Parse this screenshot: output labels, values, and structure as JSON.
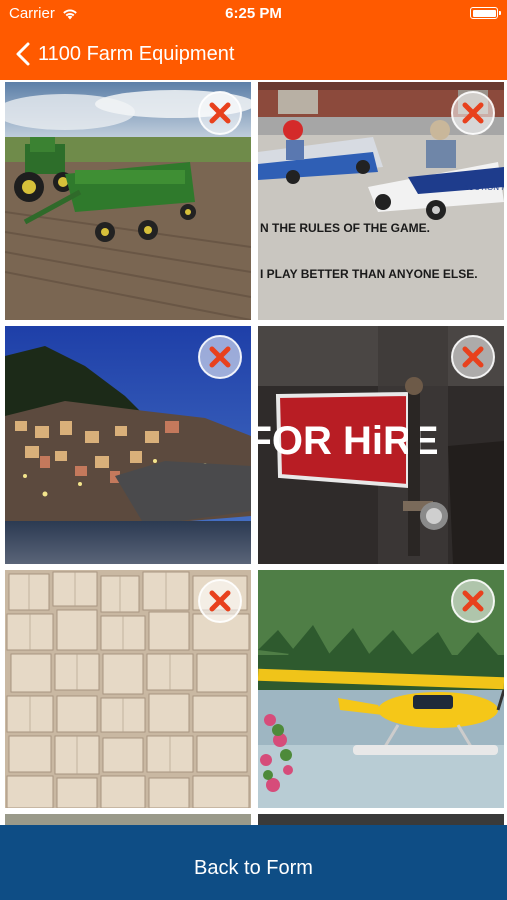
{
  "status_bar": {
    "carrier": "Carrier",
    "time": "6:25 PM"
  },
  "nav": {
    "title": "1100 Farm Equipment"
  },
  "images": [
    {
      "subject": "green tractor pulling seed drill in plowed field",
      "remove_icon": "close-icon"
    },
    {
      "subject": "children racing soapbox derby cars",
      "caption_lines": [
        "N THE RULES OF THE GAME.",
        "I PLAY BETTER THAN ANYONE ELSE."
      ],
      "car_text": "AUCTION METHO",
      "remove_icon": "close-icon"
    },
    {
      "subject": "coastal village on cliff at dusk",
      "remove_icon": "close-icon"
    },
    {
      "subject": "red for hire sign on post",
      "sign_text": "FOR HiRE",
      "remove_icon": "close-icon"
    },
    {
      "subject": "open books laid flat on wall",
      "remove_icon": "close-icon"
    },
    {
      "subject": "yellow seaplane on lake with forested hills",
      "remove_icon": "close-icon"
    }
  ],
  "footer": {
    "button_label": "Back to Form"
  },
  "colors": {
    "header": "#ff5a00",
    "footer": "#0e4d85",
    "remove_x": "#e8411d"
  }
}
